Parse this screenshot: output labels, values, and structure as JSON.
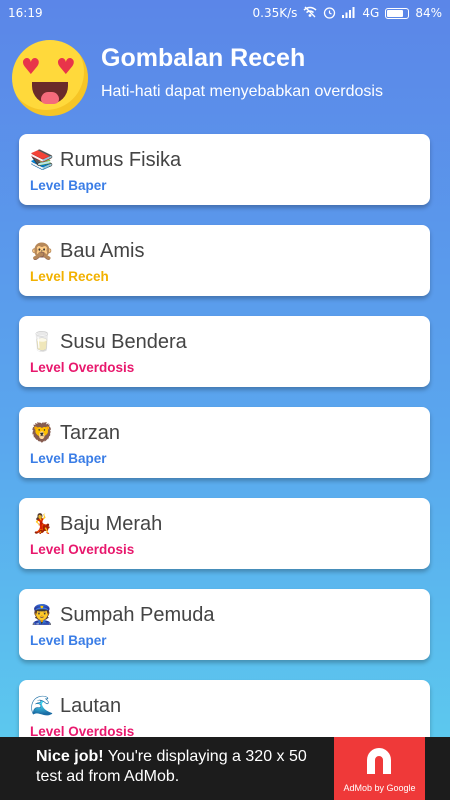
{
  "status_bar": {
    "time": "16:19",
    "network_speed": "0.35K/s",
    "network_type": "4G",
    "battery_percent": "84%",
    "battery_level": 0.84,
    "icons": [
      "wifi-off-icon",
      "alarm-icon",
      "signal-icon"
    ]
  },
  "header": {
    "title": "Gombalan Receh",
    "subtitle": "Hati-hati dapat menyebabkan overdosis",
    "avatar_icon": "heart-eyes-emoji-icon"
  },
  "colors": {
    "baper": "#3a7de6",
    "receh": "#f2b100",
    "overdosis": "#e8186d"
  },
  "items": [
    {
      "emoji": "📚",
      "icon": "books-icon",
      "title": "Rumus Fisika",
      "level": "Level Baper",
      "level_type": "baper"
    },
    {
      "emoji": "🙊",
      "icon": "monkey-icon",
      "title": "Bau Amis",
      "level": "Level Receh",
      "level_type": "receh"
    },
    {
      "emoji": "🥛",
      "icon": "milk-glass-icon",
      "title": "Susu Bendera",
      "level": "Level Overdosis",
      "level_type": "overdosis"
    },
    {
      "emoji": "🦁",
      "icon": "lion-icon",
      "title": "Tarzan",
      "level": "Level Baper",
      "level_type": "baper"
    },
    {
      "emoji": "💃",
      "icon": "dancer-icon",
      "title": "Baju Merah",
      "level": "Level Overdosis",
      "level_type": "overdosis"
    },
    {
      "emoji": "👮",
      "icon": "police-officer-icon",
      "title": "Sumpah Pemuda",
      "level": "Level Baper",
      "level_type": "baper"
    },
    {
      "emoji": "🌊",
      "icon": "wave-icon",
      "title": "Lautan",
      "level": "Level Overdosis",
      "level_type": "overdosis"
    }
  ],
  "ad": {
    "bold_text": "Nice job!",
    "text": " You're displaying a 320 x 50 test ad from AdMob.",
    "brand": "AdMob by Google"
  }
}
